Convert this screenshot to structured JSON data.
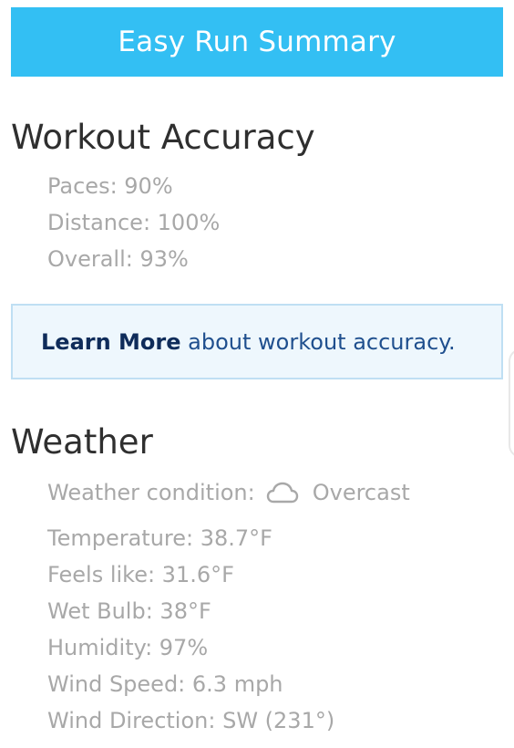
{
  "header": {
    "title": "Easy Run Summary"
  },
  "workout_accuracy": {
    "title": "Workout Accuracy",
    "stats": [
      "Paces: 90%",
      "Distance: 100%",
      "Overall: 93%"
    ]
  },
  "info": {
    "link_label": "Learn More",
    "text": " about workout accuracy."
  },
  "weather": {
    "title": "Weather",
    "condition_label": "Weather condition:",
    "condition_icon": "cloud-icon",
    "condition_value": "Overcast",
    "stats": [
      "Temperature: 38.7°F",
      "Feels like: 31.6°F",
      "Wet Bulb: 38°F",
      "Humidity: 97%",
      "Wind Speed: 6.3 mph",
      "Wind Direction: SW (231°)"
    ]
  },
  "colors": {
    "header_bg": "#33bff3",
    "header_text": "#ffffff",
    "section_title": "#2f2f2f",
    "stat_text": "#a8a8a8",
    "info_bg": "#eef7fd",
    "info_border": "#bfdff3",
    "link_text": "#0f2c5a",
    "info_text": "#1f4f8e"
  }
}
